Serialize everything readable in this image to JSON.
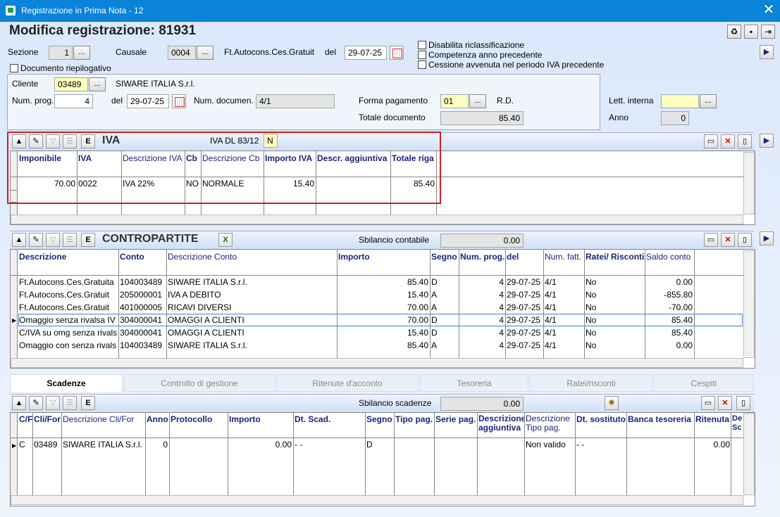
{
  "window": {
    "title": "Registrazione in Prima Nota - 12",
    "close": "✕"
  },
  "header": {
    "title": "Modifica registrazione:  81931"
  },
  "form": {
    "sezione_label": "Sezione",
    "sezione": "1",
    "causale_label": "Causale",
    "causale": "0004",
    "causale_desc": "Ft.Autocons.Ces.Gratuit",
    "del_label": "del",
    "data": "29-07-25",
    "doc_riep": "Documento riepilogativo",
    "opt1": "Disabilita riclassificazione",
    "opt2": "Competenza anno precedente",
    "opt3": "Cessione avvenuta nel periodo IVA precedente",
    "cliente_label": "Cliente",
    "cliente": "03489",
    "cliente_nome": "SIWARE ITALIA S.r.l.",
    "numprog_label": "Num. prog.",
    "numprog": "4",
    "del2_label": "del",
    "data2": "29-07-25",
    "numdoc_label": "Num. documen.",
    "numdoc": "4/1",
    "formapag_label": "Forma pagamento",
    "formapag": "01",
    "formapag_desc": "R.D.",
    "totdoc_label": "Totale documento",
    "totdoc": "85.40",
    "lett_label": "Lett. interna",
    "lett": "",
    "anno_label": "Anno",
    "anno": "0",
    "dots": "..."
  },
  "iva": {
    "title": "IVA",
    "dl_label": "IVA DL 83/12",
    "dl_value": "N",
    "headers": [
      "Imponibile",
      "IVA",
      "Descrizione IVA",
      "Cb",
      "Descrizione Cb",
      "Importo IVA",
      "Descr. aggiuntiva",
      "Totale riga"
    ],
    "rows": [
      [
        "70.00",
        "0022",
        "IVA 22%",
        "NO",
        "NORMALE",
        "15.40",
        "",
        "85.40"
      ]
    ]
  },
  "contropartite": {
    "title": "CONTROPARTITE",
    "sbil_label": "Sbilancio contabile",
    "sbil": "0.00",
    "headers": [
      "Descrizione",
      "Conto",
      "Descrizione Conto",
      "Importo",
      "Segno",
      "Num. prog.",
      "del",
      "Num. fatt.",
      "Ratei/ Risconti",
      "Saldo conto"
    ],
    "rows": [
      [
        "Ft.Autocons.Ces.Gratuita",
        "104003489",
        "SIWARE ITALIA S.r.l.",
        "85.40",
        "D",
        "4",
        "29-07-25",
        "4/1",
        "No",
        "0.00"
      ],
      [
        "Ft.Autocons.Ces.Gratuit",
        "205000001",
        "IVA A DEBITO",
        "15.40",
        "A",
        "4",
        "29-07-25",
        "4/1",
        "No",
        "-855.80"
      ],
      [
        "Ft.Autocons.Ces.Gratuit",
        "401000005",
        "RICAVI DIVERSI",
        "70.00",
        "A",
        "4",
        "29-07-25",
        "4/1",
        "No",
        "-70.00"
      ],
      [
        "Omaggio senza rivalsa IV",
        "304000041",
        "OMAGGI A CLIENTI",
        "70.00",
        "D",
        "4",
        "29-07-25",
        "4/1",
        "No",
        "85.40"
      ],
      [
        "C/IVA su omg senza rivals",
        "304000041",
        "OMAGGI A CLIENTI",
        "15.40",
        "D",
        "4",
        "29-07-25",
        "4/1",
        "No",
        "85.40"
      ],
      [
        "Omaggio con senza rivals",
        "104003489",
        "SIWARE ITALIA S.r.l.",
        "85.40",
        "A",
        "4",
        "29-07-25",
        "4/1",
        "No",
        "0.00"
      ]
    ]
  },
  "tabs": [
    "Scadenze",
    "Controllo di gestione",
    "Ritenute d'acconto",
    "Tesoreria",
    "Ratei/risconti",
    "Cespiti"
  ],
  "scadenze": {
    "sbil_label": "Sbilancio scadenze",
    "sbil": "0.00",
    "headers": [
      "C/F",
      "Cli/For",
      "Descrizione Cli/For",
      "Anno",
      "Protocollo",
      "Importo",
      "Dt. Scad.",
      "Segno",
      "Tipo pag.",
      "Serie pag.",
      "Descrizione aggiuntiva",
      "Descrizione Tipo pag.",
      "Dt. sostituto",
      "Banca tesoreria",
      "Ritenuta",
      "De Sc"
    ],
    "rows": [
      [
        "C",
        "03489",
        "SIWARE ITALIA S.r.l.",
        "0",
        "",
        "0.00",
        "-  -",
        "D",
        "",
        "",
        "",
        "Non valido",
        "-  -",
        "",
        "0.00",
        ""
      ]
    ]
  }
}
